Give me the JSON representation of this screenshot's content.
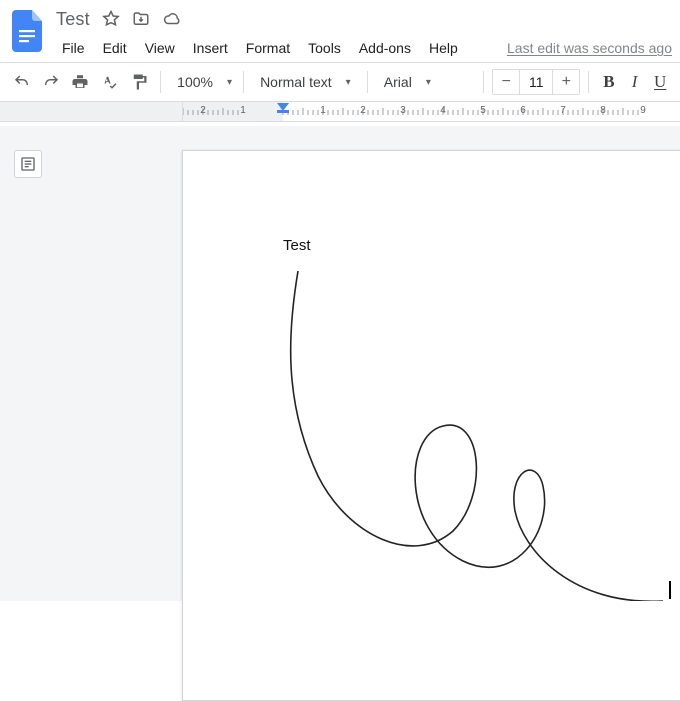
{
  "doc": {
    "title": "Test",
    "last_edit": "Last edit was seconds ago"
  },
  "menu": {
    "file": "File",
    "edit": "Edit",
    "view": "View",
    "insert": "Insert",
    "format": "Format",
    "tools": "Tools",
    "addons": "Add-ons",
    "help": "Help"
  },
  "toolbar": {
    "zoom": "100%",
    "style": "Normal text",
    "font": "Arial",
    "font_size": "11",
    "bold": "B",
    "italic": "I",
    "underline": "U"
  },
  "ruler": {
    "labels": [
      "2",
      "1",
      "1",
      "2",
      "3",
      "4",
      "5",
      "6",
      "7",
      "8",
      "9"
    ]
  },
  "body": {
    "text": "Test"
  }
}
